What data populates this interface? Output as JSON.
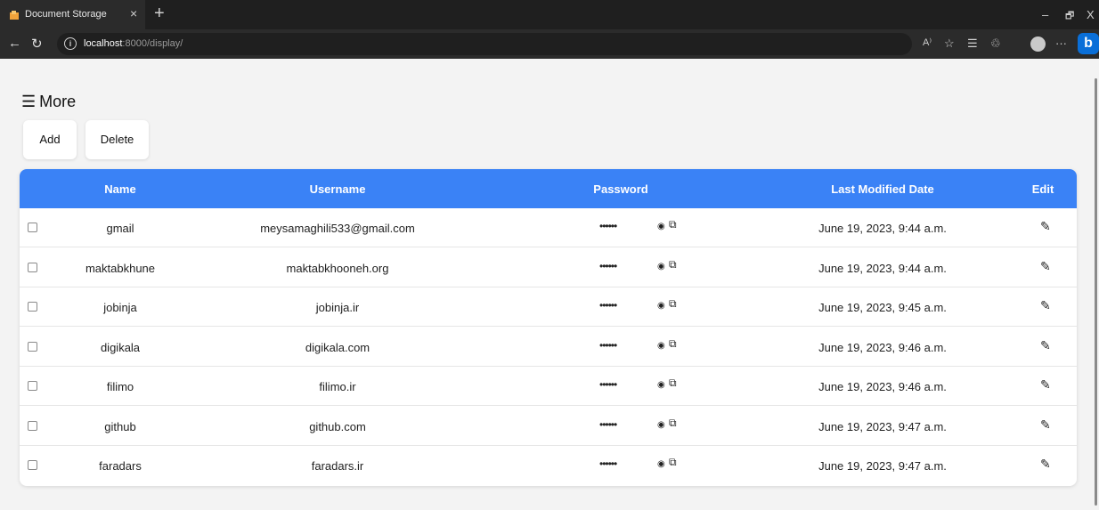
{
  "browser": {
    "tab_title": "Document Storage",
    "tab_close": "×",
    "new_tab": "+",
    "url_host": "localhost",
    "url_path": ":8000/display/",
    "minimize": "–",
    "restore": "🗗",
    "close": "X",
    "read_aloud": "A⁾",
    "bing": "b",
    "more": "···"
  },
  "menu": {
    "label": "More"
  },
  "actions": {
    "add": "Add",
    "delete": "Delete"
  },
  "table": {
    "headers": {
      "name": "Name",
      "username": "Username",
      "password": "Password",
      "date": "Last Modified Date",
      "edit": "Edit"
    },
    "rows": [
      {
        "name": "gmail",
        "username": "meysamaghili533@gmail.com",
        "password": "••••••",
        "date": "June 19, 2023, 9:44 a.m."
      },
      {
        "name": "maktabkhune",
        "username": "maktabkhooneh.org",
        "password": "••••••",
        "date": "June 19, 2023, 9:44 a.m."
      },
      {
        "name": "jobinja",
        "username": "jobinja.ir",
        "password": "••••••",
        "date": "June 19, 2023, 9:45 a.m."
      },
      {
        "name": "digikala",
        "username": "digikala.com",
        "password": "••••••",
        "date": "June 19, 2023, 9:46 a.m."
      },
      {
        "name": "filimo",
        "username": "filimo.ir",
        "password": "••••••",
        "date": "June 19, 2023, 9:46 a.m."
      },
      {
        "name": "github",
        "username": "github.com",
        "password": "••••••",
        "date": "June 19, 2023, 9:47 a.m."
      },
      {
        "name": "faradars",
        "username": "faradars.ir",
        "password": "••••••",
        "date": "June 19, 2023, 9:47 a.m."
      }
    ]
  },
  "colors": {
    "header_bg": "#3a82f6",
    "page_bg": "#f3f3f3",
    "chrome_bg": "#1f1f1f"
  }
}
